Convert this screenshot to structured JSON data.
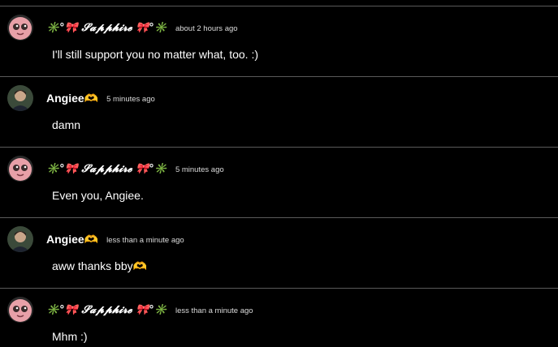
{
  "messages": [
    {
      "user": "✳️°🎀 𝓢𝓪𝓹𝓹𝓱𝓲𝓻𝓮 🎀°✳️",
      "time": "about 2 hours ago",
      "text": "I'll still support you no matter what, too. :)",
      "avatar": "pink-creature-avatar"
    },
    {
      "user": "Angiee🫶",
      "time": "5 minutes ago",
      "text": "damn",
      "avatar": "photo-avatar"
    },
    {
      "user": "✳️°🎀 𝓢𝓪𝓹𝓹𝓱𝓲𝓻𝓮 🎀°✳️",
      "time": "5 minutes ago",
      "text": "Even you, Angiee.",
      "avatar": "pink-creature-avatar"
    },
    {
      "user": "Angiee🫶",
      "time": "less than a minute ago",
      "text": "aww thanks bby🫶",
      "avatar": "photo-avatar"
    },
    {
      "user": "✳️°🎀 𝓢𝓪𝓹𝓹𝓱𝓲𝓻𝓮 🎀°✳️",
      "time": "less than a minute ago",
      "text": "Mhm :)",
      "avatar": "pink-creature-avatar"
    }
  ],
  "colors": {
    "background": "#000000",
    "divider": "#5a5a5a",
    "text": "#ffffff",
    "timestamp": "#dcdcdc",
    "avatar_pink": "#e8a0a8"
  }
}
